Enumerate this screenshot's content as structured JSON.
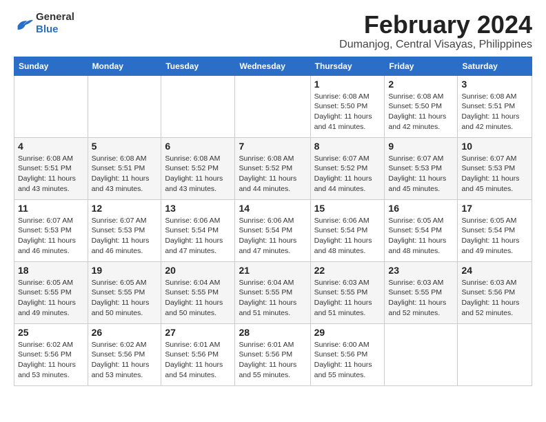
{
  "header": {
    "logo_general": "General",
    "logo_blue": "Blue",
    "month_title": "February 2024",
    "location": "Dumanjog, Central Visayas, Philippines"
  },
  "weekdays": [
    "Sunday",
    "Monday",
    "Tuesday",
    "Wednesday",
    "Thursday",
    "Friday",
    "Saturday"
  ],
  "weeks": [
    [
      {
        "day": "",
        "info": ""
      },
      {
        "day": "",
        "info": ""
      },
      {
        "day": "",
        "info": ""
      },
      {
        "day": "",
        "info": ""
      },
      {
        "day": "1",
        "info": "Sunrise: 6:08 AM\nSunset: 5:50 PM\nDaylight: 11 hours\nand 41 minutes."
      },
      {
        "day": "2",
        "info": "Sunrise: 6:08 AM\nSunset: 5:50 PM\nDaylight: 11 hours\nand 42 minutes."
      },
      {
        "day": "3",
        "info": "Sunrise: 6:08 AM\nSunset: 5:51 PM\nDaylight: 11 hours\nand 42 minutes."
      }
    ],
    [
      {
        "day": "4",
        "info": "Sunrise: 6:08 AM\nSunset: 5:51 PM\nDaylight: 11 hours\nand 43 minutes."
      },
      {
        "day": "5",
        "info": "Sunrise: 6:08 AM\nSunset: 5:51 PM\nDaylight: 11 hours\nand 43 minutes."
      },
      {
        "day": "6",
        "info": "Sunrise: 6:08 AM\nSunset: 5:52 PM\nDaylight: 11 hours\nand 43 minutes."
      },
      {
        "day": "7",
        "info": "Sunrise: 6:08 AM\nSunset: 5:52 PM\nDaylight: 11 hours\nand 44 minutes."
      },
      {
        "day": "8",
        "info": "Sunrise: 6:07 AM\nSunset: 5:52 PM\nDaylight: 11 hours\nand 44 minutes."
      },
      {
        "day": "9",
        "info": "Sunrise: 6:07 AM\nSunset: 5:53 PM\nDaylight: 11 hours\nand 45 minutes."
      },
      {
        "day": "10",
        "info": "Sunrise: 6:07 AM\nSunset: 5:53 PM\nDaylight: 11 hours\nand 45 minutes."
      }
    ],
    [
      {
        "day": "11",
        "info": "Sunrise: 6:07 AM\nSunset: 5:53 PM\nDaylight: 11 hours\nand 46 minutes."
      },
      {
        "day": "12",
        "info": "Sunrise: 6:07 AM\nSunset: 5:53 PM\nDaylight: 11 hours\nand 46 minutes."
      },
      {
        "day": "13",
        "info": "Sunrise: 6:06 AM\nSunset: 5:54 PM\nDaylight: 11 hours\nand 47 minutes."
      },
      {
        "day": "14",
        "info": "Sunrise: 6:06 AM\nSunset: 5:54 PM\nDaylight: 11 hours\nand 47 minutes."
      },
      {
        "day": "15",
        "info": "Sunrise: 6:06 AM\nSunset: 5:54 PM\nDaylight: 11 hours\nand 48 minutes."
      },
      {
        "day": "16",
        "info": "Sunrise: 6:05 AM\nSunset: 5:54 PM\nDaylight: 11 hours\nand 48 minutes."
      },
      {
        "day": "17",
        "info": "Sunrise: 6:05 AM\nSunset: 5:54 PM\nDaylight: 11 hours\nand 49 minutes."
      }
    ],
    [
      {
        "day": "18",
        "info": "Sunrise: 6:05 AM\nSunset: 5:55 PM\nDaylight: 11 hours\nand 49 minutes."
      },
      {
        "day": "19",
        "info": "Sunrise: 6:05 AM\nSunset: 5:55 PM\nDaylight: 11 hours\nand 50 minutes."
      },
      {
        "day": "20",
        "info": "Sunrise: 6:04 AM\nSunset: 5:55 PM\nDaylight: 11 hours\nand 50 minutes."
      },
      {
        "day": "21",
        "info": "Sunrise: 6:04 AM\nSunset: 5:55 PM\nDaylight: 11 hours\nand 51 minutes."
      },
      {
        "day": "22",
        "info": "Sunrise: 6:03 AM\nSunset: 5:55 PM\nDaylight: 11 hours\nand 51 minutes."
      },
      {
        "day": "23",
        "info": "Sunrise: 6:03 AM\nSunset: 5:55 PM\nDaylight: 11 hours\nand 52 minutes."
      },
      {
        "day": "24",
        "info": "Sunrise: 6:03 AM\nSunset: 5:56 PM\nDaylight: 11 hours\nand 52 minutes."
      }
    ],
    [
      {
        "day": "25",
        "info": "Sunrise: 6:02 AM\nSunset: 5:56 PM\nDaylight: 11 hours\nand 53 minutes."
      },
      {
        "day": "26",
        "info": "Sunrise: 6:02 AM\nSunset: 5:56 PM\nDaylight: 11 hours\nand 53 minutes."
      },
      {
        "day": "27",
        "info": "Sunrise: 6:01 AM\nSunset: 5:56 PM\nDaylight: 11 hours\nand 54 minutes."
      },
      {
        "day": "28",
        "info": "Sunrise: 6:01 AM\nSunset: 5:56 PM\nDaylight: 11 hours\nand 55 minutes."
      },
      {
        "day": "29",
        "info": "Sunrise: 6:00 AM\nSunset: 5:56 PM\nDaylight: 11 hours\nand 55 minutes."
      },
      {
        "day": "",
        "info": ""
      },
      {
        "day": "",
        "info": ""
      }
    ]
  ]
}
